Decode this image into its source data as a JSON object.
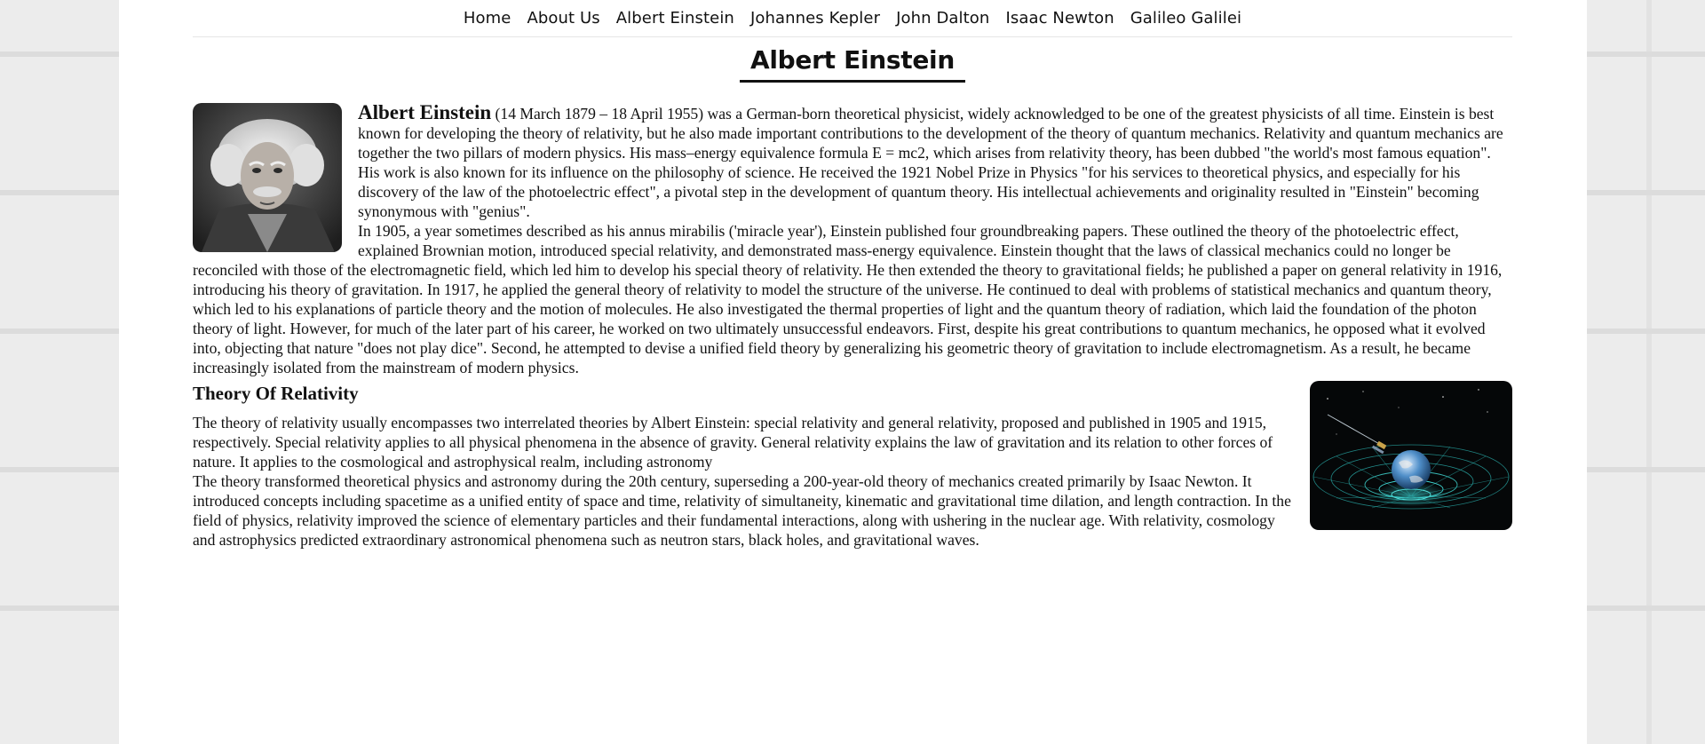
{
  "nav": {
    "items": [
      {
        "label": "Home"
      },
      {
        "label": "About Us"
      },
      {
        "label": "Albert Einstein"
      },
      {
        "label": "Johannes Kepler"
      },
      {
        "label": "John Dalton"
      },
      {
        "label": "Isaac Newton"
      },
      {
        "label": "Galileo Galilei"
      }
    ]
  },
  "page_title": "Albert Einstein",
  "intro": {
    "name": "Albert Einstein",
    "paragraph1": " (14 March 1879 – 18 April 1955) was a German-born theoretical physicist, widely acknowledged to be one of the greatest physicists of all time. Einstein is best known for developing the theory of relativity, but he also made important contributions to the development of the theory of quantum mechanics. Relativity and quantum mechanics are together the two pillars of modern physics. His mass–energy equivalence formula E = mc2, which arises from relativity theory, has been dubbed \"the world's most famous equation\". His work is also known for its influence on the philosophy of science. He received the 1921 Nobel Prize in Physics \"for his services to theoretical physics, and especially for his discovery of the law of the photoelectric effect\", a pivotal step in the development of quantum theory. His intellectual achievements and originality resulted in \"Einstein\" becoming synonymous with \"genius\".",
    "paragraph2": "In 1905, a year sometimes described as his annus mirabilis ('miracle year'), Einstein published four groundbreaking papers. These outlined the theory of the photoelectric effect, explained Brownian motion, introduced special relativity, and demonstrated mass-energy equivalence. Einstein thought that the laws of classical mechanics could no longer be reconciled with those of the electromagnetic field, which led him to develop his special theory of relativity. He then extended the theory to gravitational fields; he published a paper on general relativity in 1916, introducing his theory of gravitation. In 1917, he applied the general theory of relativity to model the structure of the universe. He continued to deal with problems of statistical mechanics and quantum theory, which led to his explanations of particle theory and the motion of molecules. He also investigated the thermal properties of light and the quantum theory of radiation, which laid the foundation of the photon theory of light. However, for much of the later part of his career, he worked on two ultimately unsuccessful endeavors. First, despite his great contributions to quantum mechanics, he opposed what it evolved into, objecting that nature \"does not play dice\". Second, he attempted to devise a unified field theory by generalizing his geometric theory of gravitation to include electromagnetism. As a result, he became increasingly isolated from the mainstream of modern physics."
  },
  "relativity": {
    "heading": "Theory Of Relativity",
    "paragraph1": "The theory of relativity usually encompasses two interrelated theories by Albert Einstein: special relativity and general relativity, proposed and published in 1905 and 1915, respectively. Special relativity applies to all physical phenomena in the absence of gravity. General relativity explains the law of gravitation and its relation to other forces of nature. It applies to the cosmological and astrophysical realm, including astronomy",
    "paragraph2": "The theory transformed theoretical physics and astronomy during the 20th century, superseding a 200-year-old theory of mechanics created primarily by Isaac Newton. It introduced concepts including spacetime as a unified entity of space and time, relativity of simultaneity, kinematic and gravitational time dilation, and length contraction. In the field of physics, relativity improved the science of elementary particles and their fundamental interactions, along with ushering in the nuclear age. With relativity, cosmology and astrophysics predicted extraordinary astronomical phenomena such as neutron stars, black holes, and gravitational waves."
  },
  "images": {
    "portrait": "einstein-portrait-photo",
    "relativity": "spacetime-curvature-earth-illustration"
  }
}
